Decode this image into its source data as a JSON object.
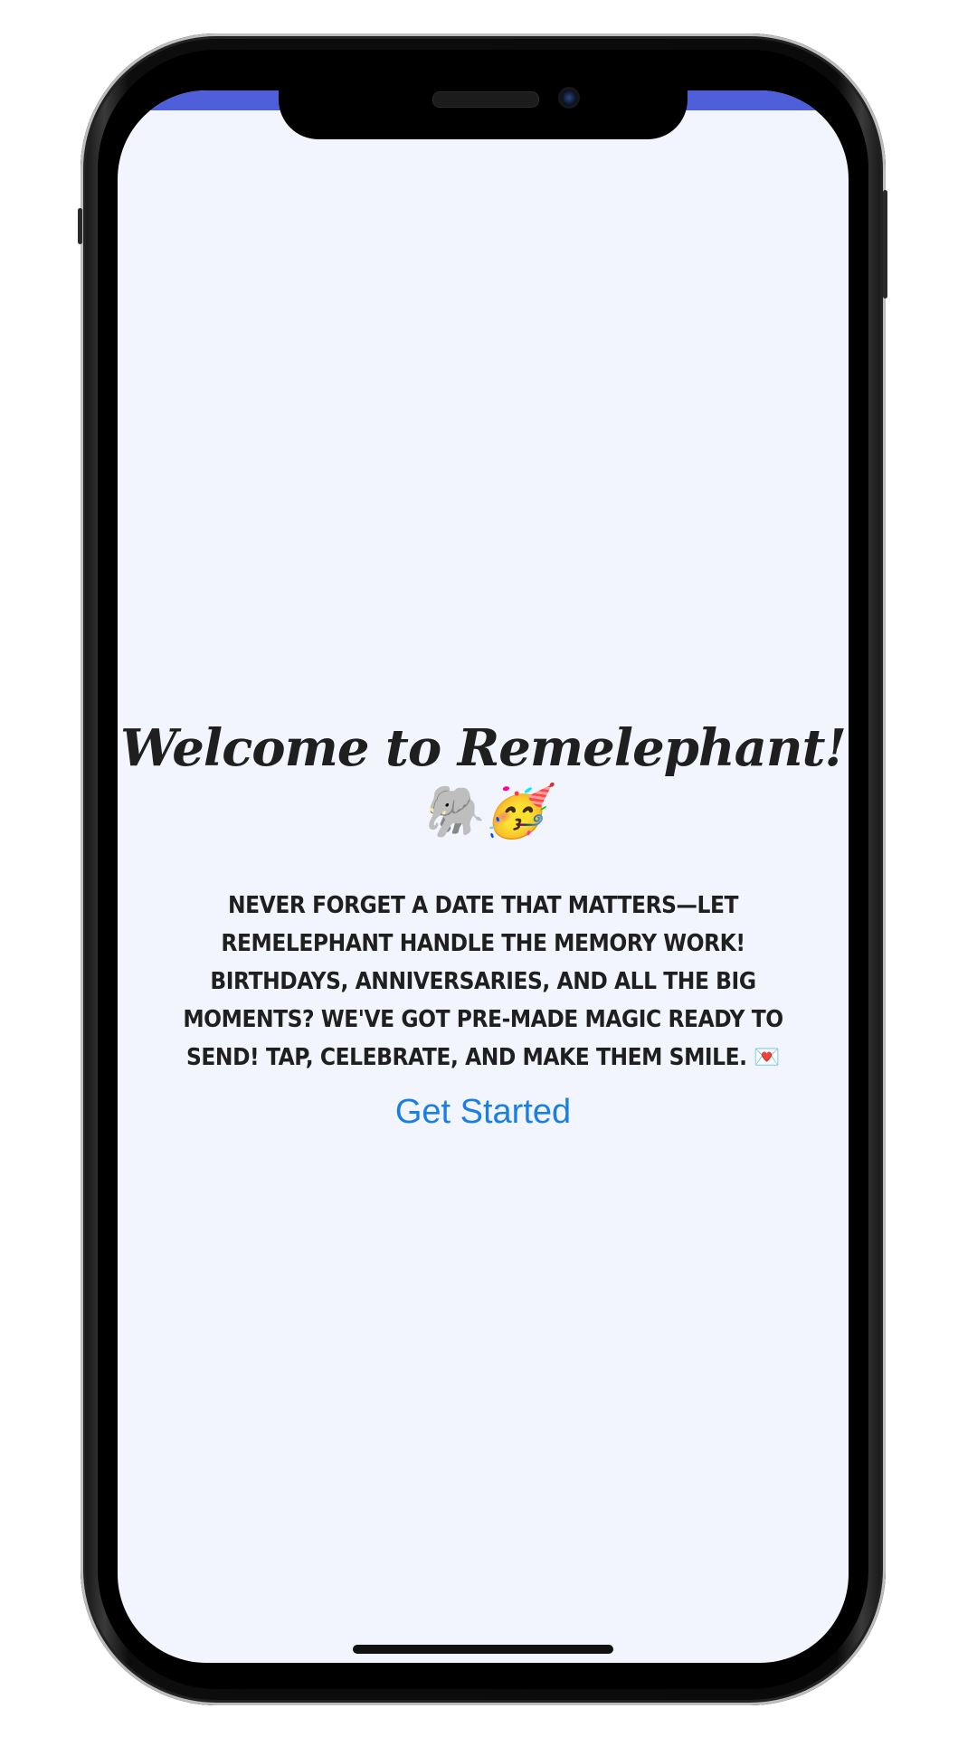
{
  "app": {
    "title": "Welcome to Remelephant!🐘🥳",
    "tagline": "Never forget a date that matters—let Remelephant handle the memory work! Birthdays, anniversaries, and all the big moments? We've got pre-made magic ready to send! Tap, celebrate, and make them smile. 💌",
    "cta_label": "Get Started"
  },
  "colors": {
    "status_bar": "#4f5fd9",
    "screen_background": "#f2f5fd",
    "link": "#1a7fe3",
    "text": "#1f1f1f"
  },
  "icons": {
    "speaker": "speaker-grille",
    "camera": "front-camera"
  }
}
